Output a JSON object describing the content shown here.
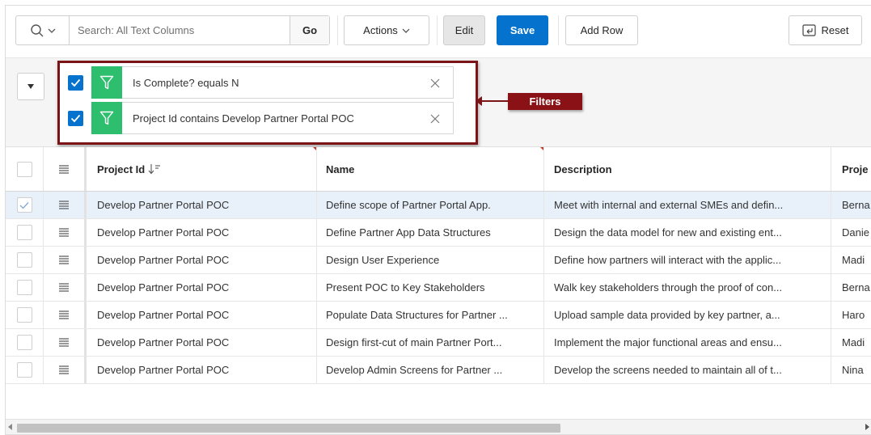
{
  "toolbar": {
    "search_placeholder": "Search: All Text Columns",
    "go_label": "Go",
    "actions_label": "Actions",
    "edit_label": "Edit",
    "save_label": "Save",
    "add_row_label": "Add Row",
    "reset_label": "Reset"
  },
  "filters": [
    {
      "text": "Is Complete? equals N",
      "enabled": true
    },
    {
      "text": "Project Id contains Develop Partner Portal POC",
      "enabled": true
    }
  ],
  "callout_label": "Filters",
  "columns": {
    "project_id": "Project Id",
    "name": "Name",
    "description": "Description",
    "project_lead": "Proje"
  },
  "rows": [
    {
      "project_id": "Develop Partner Portal POC",
      "name": "Define scope of Partner Portal App.",
      "description": "Meet with internal and external SMEs and defin...",
      "lead": "Berna",
      "selected": true
    },
    {
      "project_id": "Develop Partner Portal POC",
      "name": "Define Partner App Data Structures",
      "description": "Design the data model for new and existing ent...",
      "lead": "Danie",
      "selected": false
    },
    {
      "project_id": "Develop Partner Portal POC",
      "name": "Design User Experience",
      "description": "Define how partners will interact with the applic...",
      "lead": "Madi",
      "selected": false
    },
    {
      "project_id": "Develop Partner Portal POC",
      "name": "Present POC to Key Stakeholders",
      "description": "Walk key stakeholders through the proof of con...",
      "lead": "Berna",
      "selected": false
    },
    {
      "project_id": "Develop Partner Portal POC",
      "name": "Populate Data Structures for Partner ...",
      "description": "Upload sample data provided by key partner, a...",
      "lead": "Haro",
      "selected": false
    },
    {
      "project_id": "Develop Partner Portal POC",
      "name": "Design first-cut of main Partner Port...",
      "description": "Implement the major functional areas and ensu...",
      "lead": "Madi",
      "selected": false
    },
    {
      "project_id": "Develop Partner Portal POC",
      "name": "Develop Admin Screens for Partner ...",
      "description": "Develop the screens needed to maintain all of t...",
      "lead": "Nina",
      "selected": false
    }
  ],
  "colors": {
    "save_blue": "#0572ce",
    "filter_green": "#2ebf6e",
    "callout_red": "#8a1217",
    "selected_row": "#e8f1fa"
  }
}
